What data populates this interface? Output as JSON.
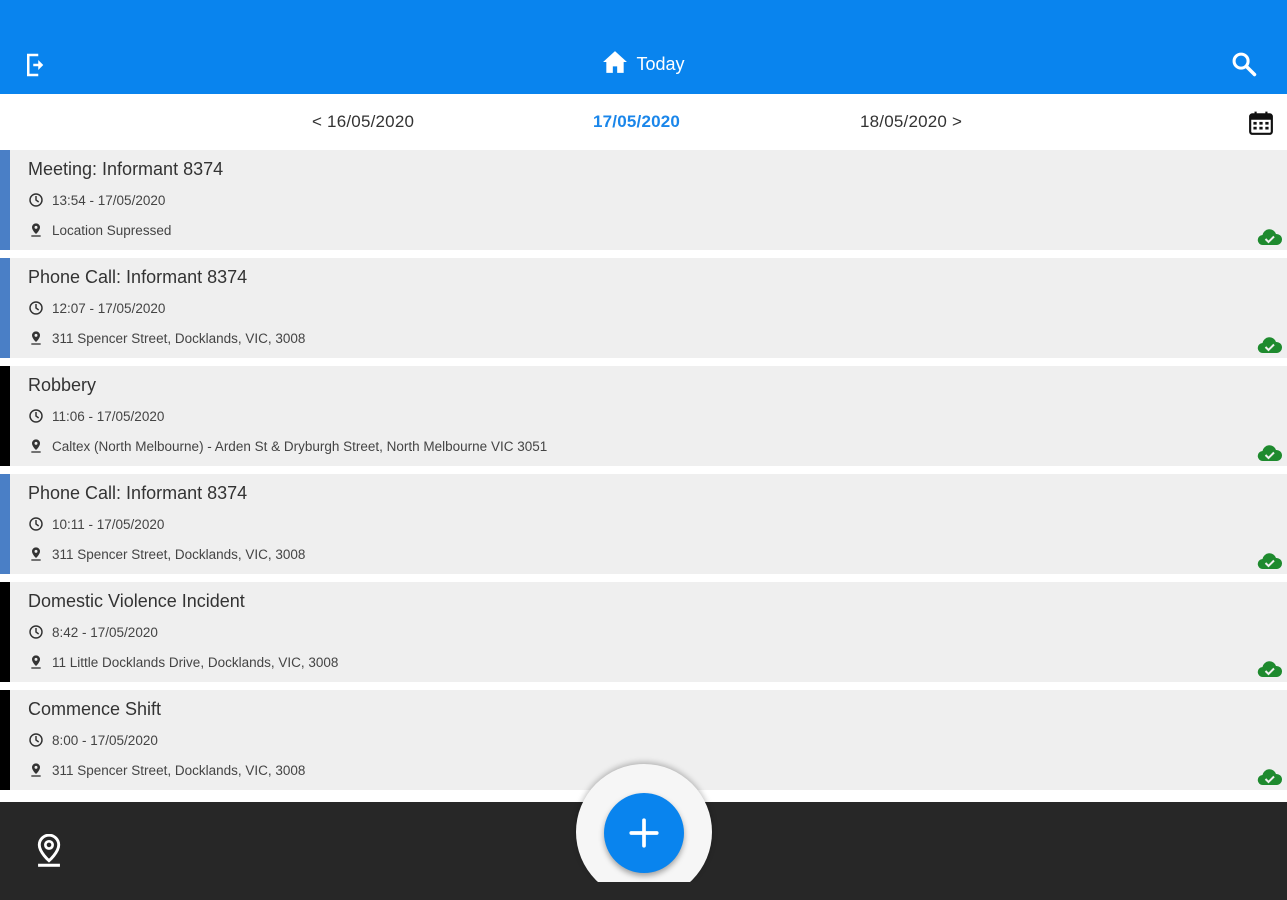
{
  "header": {
    "title": "Today",
    "color": "#0984ee"
  },
  "dates": {
    "prev": "< 16/05/2020",
    "current": "17/05/2020",
    "next": "18/05/2020 >"
  },
  "entries": [
    {
      "title": "Meeting: Informant 8374",
      "time": "13:54 - 17/05/2020",
      "location": "Location Supressed",
      "accent": "blue"
    },
    {
      "title": "Phone Call: Informant 8374",
      "time": "12:07 - 17/05/2020",
      "location": "311 Spencer Street, Docklands, VIC, 3008",
      "accent": "blue"
    },
    {
      "title": "Robbery",
      "time": "11:06 - 17/05/2020",
      "location": "Caltex (North Melbourne) - Arden St & Dryburgh Street, North Melbourne VIC 3051",
      "accent": "black"
    },
    {
      "title": "Phone Call: Informant 8374",
      "time": "10:11 - 17/05/2020",
      "location": "311 Spencer Street, Docklands, VIC, 3008",
      "accent": "blue"
    },
    {
      "title": "Domestic Violence Incident",
      "time": "8:42 - 17/05/2020",
      "location": "11 Little Docklands Drive, Docklands, VIC, 3008",
      "accent": "black"
    },
    {
      "title": "Commence Shift",
      "time": "8:00 - 17/05/2020",
      "location": "311 Spencer Street, Docklands, VIC, 3008",
      "accent": "black"
    }
  ],
  "icons": {
    "logout": "logout-icon",
    "home": "home-icon",
    "search": "search-icon",
    "calendar": "calendar-icon",
    "clock": "clock-icon",
    "pin": "map-pin-icon",
    "synced": "cloud-synced-icon",
    "add": "plus-icon"
  },
  "colors": {
    "accent_blue": "#4a7fc6",
    "synced_green": "#1e8a2e",
    "date_active": "#1a86ea"
  }
}
